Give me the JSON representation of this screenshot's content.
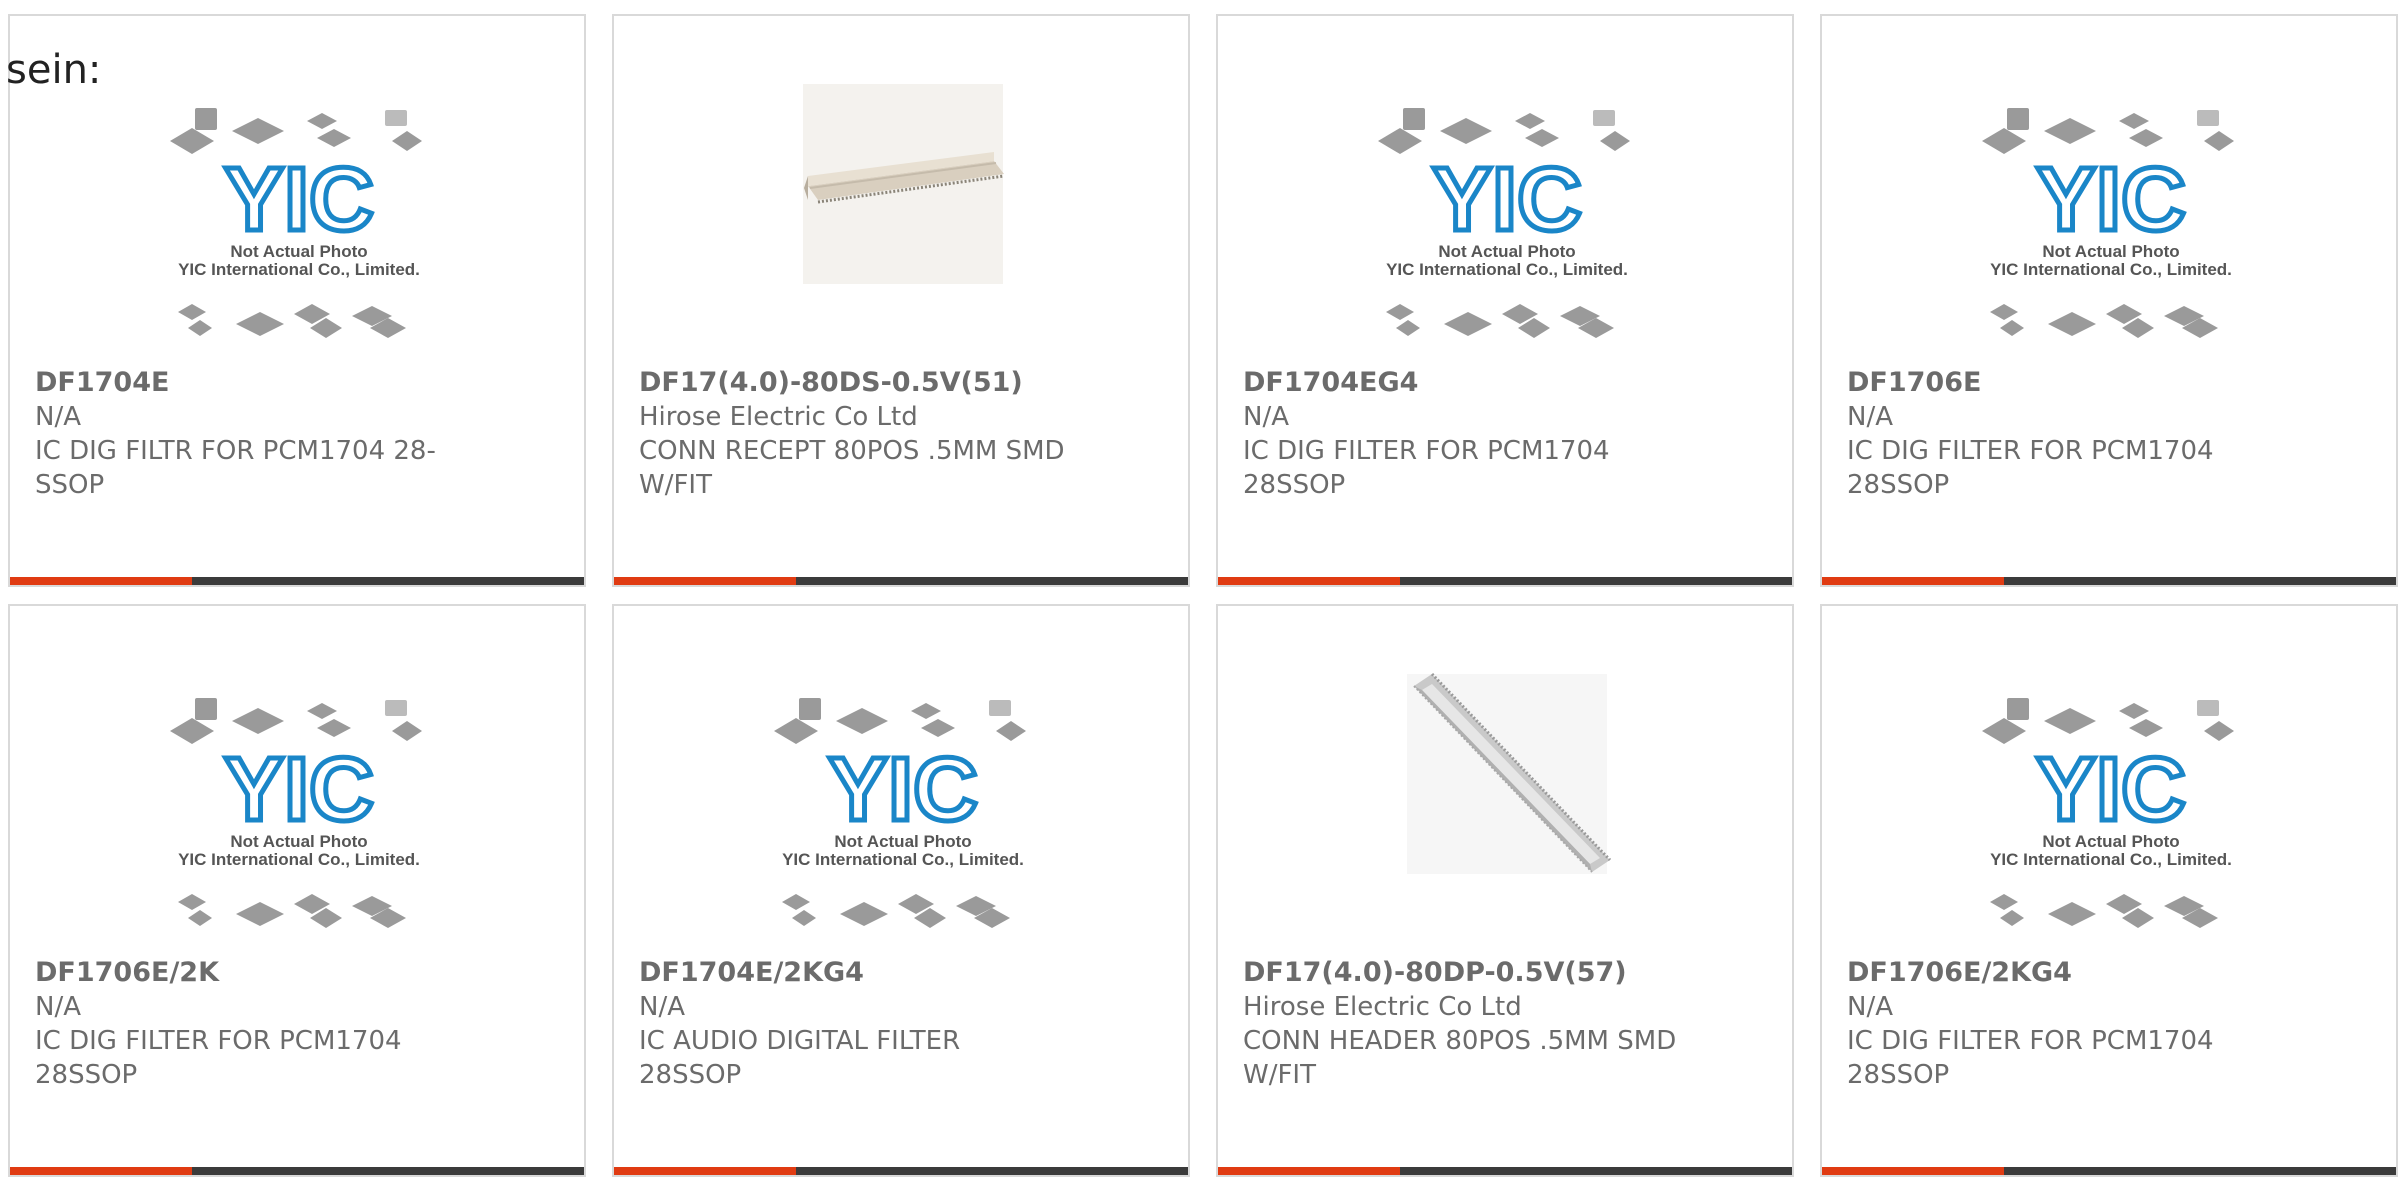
{
  "heading": "sein:",
  "colors": {
    "accent": "#e03b12",
    "bar": "#3b3b3b",
    "logo_blue": "#1a86c8",
    "text": "#6b6b6b",
    "border": "#d9d9d9"
  },
  "placeholder": {
    "logo_text": "YIC",
    "line1": "Not Actual Photo",
    "line2": "YIC International Co., Limited."
  },
  "products": [
    {
      "part_number": "DF1704E",
      "manufacturer": "N/A",
      "description_line1": "IC DIG FILTR FOR PCM1704 28-",
      "description_line2": "SSOP",
      "image": "placeholder"
    },
    {
      "part_number": "DF17(4.0)-80DS-0.5V(51)",
      "manufacturer": "Hirose Electric Co Ltd",
      "description_line1": "CONN RECEPT 80POS .5MM SMD",
      "description_line2": "W/FIT",
      "image": "connector-receptacle"
    },
    {
      "part_number": "DF1704EG4",
      "manufacturer": "N/A",
      "description_line1": "IC DIG FILTER FOR PCM1704",
      "description_line2": "28SSOP",
      "image": "placeholder"
    },
    {
      "part_number": "DF1706E",
      "manufacturer": "N/A",
      "description_line1": "IC DIG FILTER FOR PCM1704",
      "description_line2": "28SSOP",
      "image": "placeholder"
    },
    {
      "part_number": "DF1706E/2K",
      "manufacturer": "N/A",
      "description_line1": "IC DIG FILTER FOR PCM1704",
      "description_line2": "28SSOP",
      "image": "placeholder"
    },
    {
      "part_number": "DF1704E/2KG4",
      "manufacturer": "N/A",
      "description_line1": "IC AUDIO DIGITAL FILTER",
      "description_line2": "28SSOP",
      "image": "placeholder"
    },
    {
      "part_number": "DF17(4.0)-80DP-0.5V(57)",
      "manufacturer": "Hirose Electric Co Ltd",
      "description_line1": "CONN HEADER 80POS .5MM SMD",
      "description_line2": "W/FIT",
      "image": "connector-header"
    },
    {
      "part_number": "DF1706E/2KG4",
      "manufacturer": "N/A",
      "description_line1": "IC DIG FILTER FOR PCM1704",
      "description_line2": "28SSOP",
      "image": "placeholder"
    }
  ]
}
